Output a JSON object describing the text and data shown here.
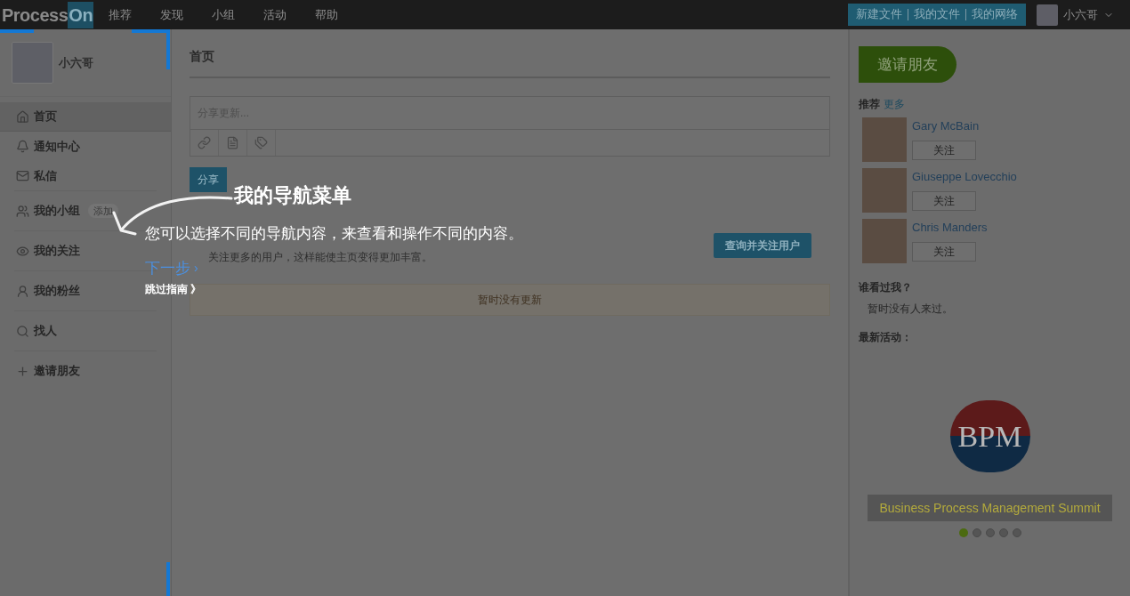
{
  "top_bar": {
    "logo": {
      "part_1": "Process",
      "part_2": "On"
    },
    "nav": [
      {
        "label": "推荐"
      },
      {
        "label": "发现"
      },
      {
        "label": "小组"
      },
      {
        "label": "活动"
      },
      {
        "label": "帮助"
      }
    ],
    "actions": [
      "新建文件",
      "我的文件",
      "我的网络"
    ],
    "user": {
      "name": "小六哥"
    }
  },
  "sidebar": {
    "profile_name": "小六哥",
    "sections": [
      {
        "items": [
          {
            "label": "首页",
            "selected": true
          },
          {
            "label": "通知中心",
            "selected": false
          },
          {
            "label": "私信",
            "selected": false
          }
        ]
      },
      {
        "items": [
          {
            "label": "我的小组",
            "selected": false,
            "badge": "添加"
          }
        ]
      },
      {
        "items": [
          {
            "label": "我的关注",
            "selected": false
          }
        ]
      },
      {
        "items": [
          {
            "label": "我的粉丝",
            "selected": false
          }
        ]
      },
      {
        "items": [
          {
            "label": "找人",
            "selected": false
          }
        ]
      },
      {
        "items": [
          {
            "label": "邀请朋友",
            "selected": false
          }
        ]
      }
    ]
  },
  "main": {
    "title": "首页",
    "composer": {
      "placeholder": "分享更新...",
      "share_button": "分享"
    },
    "suggestion": {
      "text": "关注更多的用户，这样能使主页变得更加丰富。",
      "button": "查询并关注用户"
    },
    "empty_notice": "暂时没有更新"
  },
  "right_panel": {
    "invite_button": "邀请朋友",
    "recommend": {
      "title": "推荐",
      "more": "更多",
      "people": [
        {
          "name": "Gary McBain",
          "follow": "关注"
        },
        {
          "name": "Giuseppe Lovecchio",
          "follow": "关注"
        },
        {
          "name": "Chris Manders",
          "follow": "关注"
        }
      ]
    },
    "visitors": {
      "title": "谁看过我？",
      "text": "暂时没有人来过。"
    },
    "activity": {
      "title": "最新活动：",
      "logo_text": "BPM",
      "caption": "Business Process Management Summit",
      "slides": [
        {
          "selected": true
        },
        {
          "selected": false
        },
        {
          "selected": false
        },
        {
          "selected": false
        },
        {
          "selected": false
        }
      ]
    }
  },
  "guide": {
    "title": "我的导航菜单",
    "text": "您可以选择不同的导航内容，来查看和操作不同的内容。",
    "next": "下一步",
    "next_arrow": "›",
    "skip": "跳过指南 》"
  }
}
